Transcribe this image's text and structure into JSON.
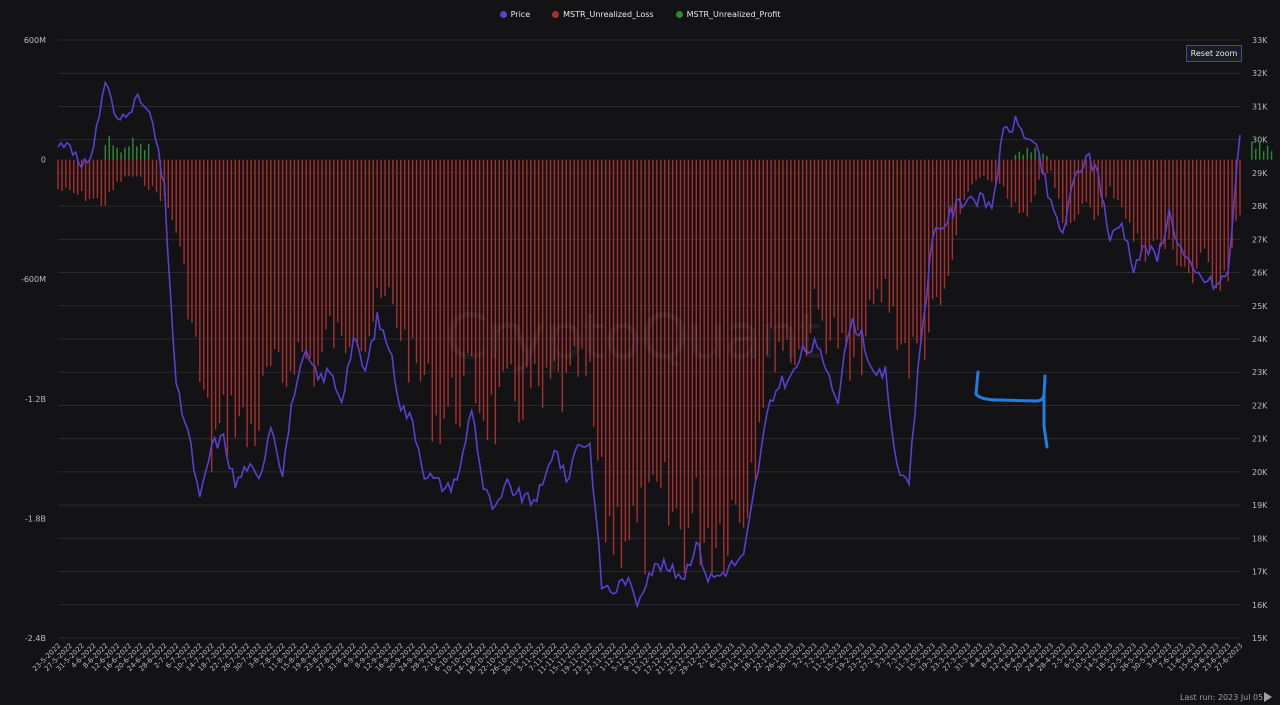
{
  "legend": {
    "price": "Price",
    "loss": "MSTR_Unrealized_Loss",
    "profit": "MSTR_Unrealized_Profit"
  },
  "reset_label": "Reset zoom",
  "last_run": "Last run: 2023 Jul 05",
  "watermark": "CryptoQuant",
  "colors": {
    "price": "#5a3fd1",
    "loss": "#a8302d",
    "profit": "#2f8a36",
    "grid": "#2a2b31",
    "annotation": "#1f7fe0"
  },
  "chart_data": {
    "type": "bar",
    "left_axis": {
      "ticks": [
        "600M",
        "0",
        "-600M",
        "-1.2B",
        "-1.8B",
        "-2.4B"
      ],
      "values": [
        600,
        0,
        -600,
        -1200,
        -1800,
        -2400
      ],
      "unit": "M",
      "range": [
        -2400,
        600
      ]
    },
    "right_axis": {
      "ticks": [
        "33K",
        "32K",
        "31K",
        "30K",
        "29K",
        "28K",
        "27K",
        "26K",
        "25K",
        "24K",
        "23K",
        "22K",
        "21K",
        "20K",
        "19K",
        "18K",
        "17K",
        "16K",
        "15K"
      ],
      "range": [
        15000,
        33000
      ]
    },
    "date_ticks": [
      "23-5-2022",
      "27-5-2022",
      "31-5-2022",
      "4-6-2022",
      "8-6-2022",
      "12-6-2022",
      "16-6-2022",
      "20-6-2022",
      "24-6-2022",
      "28-6-2022",
      "2-7-2022",
      "6-7-2022",
      "10-7-2022",
      "14-7-2022",
      "18-7-2022",
      "22-7-2022",
      "26-7-2022",
      "30-7-2022",
      "3-8-2022",
      "7-8-2022",
      "11-8-2022",
      "15-8-2022",
      "19-8-2022",
      "23-8-2022",
      "27-8-2022",
      "31-8-2022",
      "4-9-2022",
      "8-9-2022",
      "12-9-2022",
      "16-9-2022",
      "20-9-2022",
      "24-9-2022",
      "28-9-2022",
      "2-10-2022",
      "6-10-2022",
      "10-10-2022",
      "14-10-2022",
      "18-10-2022",
      "22-10-2022",
      "26-10-2022",
      "30-10-2022",
      "3-11-2022",
      "7-11-2022",
      "11-11-2022",
      "15-11-2022",
      "19-11-2022",
      "23-11-2022",
      "27-11-2022",
      "1-12-2022",
      "5-12-2022",
      "9-12-2022",
      "13-12-2022",
      "17-12-2022",
      "21-12-2022",
      "25-12-2022",
      "29-12-2022",
      "2-1-2023",
      "6-1-2023",
      "10-1-2023",
      "14-1-2023",
      "18-1-2023",
      "22-1-2023",
      "26-1-2023",
      "30-1-2023",
      "3-2-2023",
      "7-2-2023",
      "11-2-2023",
      "15-2-2023",
      "19-2-2023",
      "23-2-2023",
      "27-2-2023",
      "3-3-2023",
      "7-3-2023",
      "11-3-2023",
      "15-3-2023",
      "19-3-2023",
      "23-3-2023",
      "27-3-2023",
      "31-3-2023",
      "4-4-2023",
      "8-4-2023",
      "12-4-2023",
      "16-4-2023",
      "20-4-2023",
      "24-4-2023",
      "28-4-2023",
      "2-5-2023",
      "6-5-2023",
      "10-5-2023",
      "14-5-2023",
      "18-5-2023",
      "22-5-2023",
      "26-5-2023",
      "30-5-2023",
      "3-6-2023",
      "7-6-2023",
      "11-6-2023",
      "15-6-2023",
      "19-6-2023",
      "23-6-2023",
      "27-6-2023"
    ],
    "bar_keyframes": [
      [
        0,
        -150
      ],
      [
        2,
        -180
      ],
      [
        4,
        -220
      ],
      [
        5,
        -120
      ],
      [
        6,
        -80
      ],
      [
        7,
        -100
      ],
      [
        8,
        -150
      ],
      [
        9,
        -200
      ],
      [
        10,
        -350
      ],
      [
        11,
        -700
      ],
      [
        12,
        -1100
      ],
      [
        13,
        -1450
      ],
      [
        14,
        -1350
      ],
      [
        15,
        -1250
      ],
      [
        16,
        -1400
      ],
      [
        17,
        -1300
      ],
      [
        18,
        -1050
      ],
      [
        19,
        -1150
      ],
      [
        20,
        -950
      ],
      [
        21,
        -1000
      ],
      [
        22,
        -1050
      ],
      [
        23,
        -850
      ],
      [
        24,
        -950
      ],
      [
        25,
        -800
      ],
      [
        26,
        -900
      ],
      [
        27,
        -750
      ],
      [
        28,
        -700
      ],
      [
        29,
        -850
      ],
      [
        30,
        -1050
      ],
      [
        31,
        -1100
      ],
      [
        32,
        -1300
      ],
      [
        33,
        -1250
      ],
      [
        34,
        -1200
      ],
      [
        35,
        -1100
      ],
      [
        36,
        -1250
      ],
      [
        37,
        -1300
      ],
      [
        38,
        -1200
      ],
      [
        39,
        -1200
      ],
      [
        40,
        -1150
      ],
      [
        41,
        -1250
      ],
      [
        42,
        -1100
      ],
      [
        43,
        -1200
      ],
      [
        44,
        -1050
      ],
      [
        45,
        -1150
      ],
      [
        46,
        -1750
      ],
      [
        47,
        -1850
      ],
      [
        48,
        -1800
      ],
      [
        49,
        -1900
      ],
      [
        50,
        -1850
      ],
      [
        51,
        -1750
      ],
      [
        52,
        -1800
      ],
      [
        53,
        -1850
      ],
      [
        54,
        -1800
      ],
      [
        55,
        -1850
      ],
      [
        56,
        -1850
      ],
      [
        57,
        -1750
      ],
      [
        58,
        -1700
      ],
      [
        59,
        -1400
      ],
      [
        60,
        -1000
      ],
      [
        61,
        -900
      ],
      [
        62,
        -950
      ],
      [
        63,
        -950
      ],
      [
        64,
        -750
      ],
      [
        65,
        -850
      ],
      [
        66,
        -900
      ],
      [
        67,
        -1100
      ],
      [
        68,
        -950
      ],
      [
        69,
        -750
      ],
      [
        70,
        -650
      ],
      [
        71,
        -850
      ],
      [
        72,
        -1000
      ],
      [
        73,
        -950
      ],
      [
        74,
        -800
      ],
      [
        75,
        -700
      ],
      [
        76,
        -400
      ],
      [
        77,
        -150
      ],
      [
        78,
        -80
      ],
      [
        79,
        -120
      ],
      [
        80,
        -150
      ],
      [
        81,
        -250
      ],
      [
        82,
        -300
      ],
      [
        83,
        -100
      ],
      [
        84,
        -50
      ],
      [
        85,
        -280
      ],
      [
        86,
        -350
      ],
      [
        87,
        -200
      ],
      [
        88,
        -300
      ],
      [
        89,
        -150
      ],
      [
        90,
        -220
      ],
      [
        91,
        -400
      ],
      [
        92,
        -450
      ],
      [
        93,
        -420
      ],
      [
        94,
        -450
      ],
      [
        95,
        -500
      ],
      [
        96,
        -600
      ],
      [
        97,
        -500
      ],
      [
        98,
        -600
      ],
      [
        99,
        -550
      ],
      [
        100,
        -250
      ],
      [
        101,
        -50
      ],
      [
        102,
        -150
      ]
    ],
    "profit_keyframes": [
      [
        4,
        120
      ],
      [
        5,
        60
      ],
      [
        6,
        110
      ],
      [
        7,
        80
      ],
      [
        81,
        40
      ],
      [
        82,
        60
      ],
      [
        83,
        30
      ],
      [
        101,
        90
      ],
      [
        102,
        70
      ]
    ],
    "price_keyframes": [
      [
        0,
        29800
      ],
      [
        1,
        30000
      ],
      [
        2,
        29000
      ],
      [
        3,
        29800
      ],
      [
        4,
        31800
      ],
      [
        5,
        30500
      ],
      [
        6,
        31000
      ],
      [
        7,
        31200
      ],
      [
        8,
        30500
      ],
      [
        9,
        28500
      ],
      [
        10,
        22500
      ],
      [
        11,
        21200
      ],
      [
        12,
        19100
      ],
      [
        13,
        20800
      ],
      [
        14,
        21000
      ],
      [
        15,
        19600
      ],
      [
        16,
        20200
      ],
      [
        17,
        19700
      ],
      [
        18,
        21500
      ],
      [
        19,
        20000
      ],
      [
        20,
        22500
      ],
      [
        21,
        23500
      ],
      [
        22,
        22800
      ],
      [
        23,
        23000
      ],
      [
        24,
        22200
      ],
      [
        25,
        24000
      ],
      [
        26,
        23000
      ],
      [
        27,
        24600
      ],
      [
        28,
        23800
      ],
      [
        29,
        22000
      ],
      [
        30,
        21500
      ],
      [
        31,
        20000
      ],
      [
        32,
        19700
      ],
      [
        33,
        19500
      ],
      [
        34,
        20000
      ],
      [
        35,
        22000
      ],
      [
        36,
        19500
      ],
      [
        37,
        18800
      ],
      [
        38,
        19600
      ],
      [
        39,
        19300
      ],
      [
        40,
        19100
      ],
      [
        41,
        19500
      ],
      [
        42,
        20800
      ],
      [
        43,
        19700
      ],
      [
        44,
        20900
      ],
      [
        45,
        20800
      ],
      [
        46,
        16600
      ],
      [
        47,
        16400
      ],
      [
        48,
        16800
      ],
      [
        49,
        16100
      ],
      [
        50,
        17000
      ],
      [
        51,
        17200
      ],
      [
        52,
        17000
      ],
      [
        53,
        16900
      ],
      [
        54,
        17900
      ],
      [
        55,
        16800
      ],
      [
        56,
        16900
      ],
      [
        57,
        17200
      ],
      [
        58,
        17400
      ],
      [
        59,
        19600
      ],
      [
        60,
        21700
      ],
      [
        61,
        22700
      ],
      [
        62,
        22800
      ],
      [
        63,
        23600
      ],
      [
        64,
        23800
      ],
      [
        65,
        23200
      ],
      [
        66,
        22200
      ],
      [
        67,
        24500
      ],
      [
        68,
        24200
      ],
      [
        69,
        22800
      ],
      [
        70,
        23000
      ],
      [
        71,
        20000
      ],
      [
        72,
        19800
      ],
      [
        73,
        24000
      ],
      [
        74,
        27000
      ],
      [
        75,
        27500
      ],
      [
        76,
        28000
      ],
      [
        77,
        28300
      ],
      [
        78,
        28200
      ],
      [
        79,
        28000
      ],
      [
        80,
        30200
      ],
      [
        81,
        30500
      ],
      [
        82,
        30100
      ],
      [
        83,
        29500
      ],
      [
        84,
        28000
      ],
      [
        85,
        27200
      ],
      [
        86,
        28800
      ],
      [
        87,
        29500
      ],
      [
        88,
        29000
      ],
      [
        89,
        27000
      ],
      [
        90,
        27500
      ],
      [
        91,
        26200
      ],
      [
        92,
        26800
      ],
      [
        93,
        26400
      ],
      [
        94,
        27800
      ],
      [
        95,
        26700
      ],
      [
        96,
        26000
      ],
      [
        97,
        25800
      ],
      [
        98,
        25600
      ],
      [
        99,
        26000
      ],
      [
        100,
        30200
      ],
      [
        101,
        30500
      ],
      [
        102,
        30300
      ]
    ]
  }
}
